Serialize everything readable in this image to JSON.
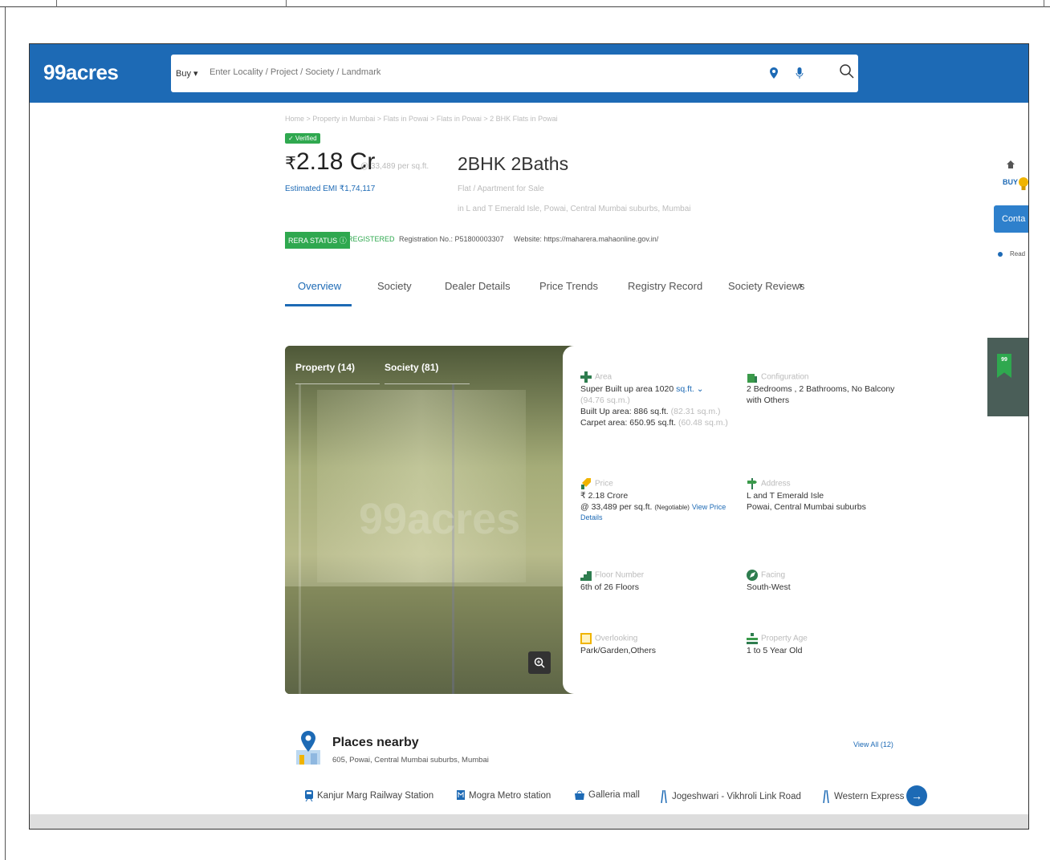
{
  "header": {
    "logo": "99acres",
    "search_type": "Buy",
    "search_placeholder": "Enter Locality / Project / Society / Landmark"
  },
  "breadcrumb": "Home > Property in Mumbai > Flats in Powai > Flats in Powai > 2 BHK Flats in Powai",
  "listing": {
    "verified_badge": "✓ Verified",
    "price": "2.18 Cr",
    "currency": "₹",
    "price_per_sqft": "@ 33,489 per sq.ft.",
    "emi": "Estimated EMI ₹1,74,117",
    "configuration": "2BHK 2Baths",
    "subtype": "Flat / Apartment for Sale",
    "sub_location": "in L and T Emerald Isle, Powai, Central Mumbai suburbs, Mumbai"
  },
  "rera": {
    "status_label": "RERA STATUS",
    "status_value": "REGISTERED",
    "registration": "Registration No.: P51800003307",
    "website": "Website: https://maharera.mahaonline.gov.in/"
  },
  "tabs": [
    "Overview",
    "Society",
    "Dealer Details",
    "Price Trends",
    "Registry Record",
    "Society Reviews"
  ],
  "gallery": {
    "tab_property": "Property (14)",
    "tab_society": "Society (81)",
    "watermark": "99acres"
  },
  "attributes": {
    "area": {
      "label": "Area",
      "super_built_up": "Super Built up area 1020",
      "unit": "sq.ft.",
      "super_built_up_sqm": "(94.76 sq.m.)",
      "built_up": "Built Up area: 886 sq.ft.",
      "built_up_sqm": "(82.31 sq.m.)",
      "carpet": "Carpet area: 650.95 sq.ft.",
      "carpet_sqm": "(60.48 sq.m.)"
    },
    "configuration": {
      "label": "Configuration",
      "line1": "2 Bedrooms , 2 Bathrooms, No Balcony",
      "line2": "with Others"
    },
    "price": {
      "label": "Price",
      "line1": "₹ 2.18 Crore",
      "line2": "@ 33,489 per sq.ft.",
      "negotiable": "(Negotiable)",
      "link1": "View Price",
      "link2": "Details"
    },
    "address": {
      "label": "Address",
      "line1": "L and T Emerald Isle",
      "line2": "Powai, Central Mumbai suburbs"
    },
    "floor": {
      "label": "Floor Number",
      "line1": "6th of 26 Floors"
    },
    "facing": {
      "label": "Facing",
      "line1": "South-West"
    },
    "overlooking": {
      "label": "Overlooking",
      "line1": "Park/Garden,Others"
    },
    "property_age": {
      "label": "Property Age",
      "line1": "1 to 5 Year Old"
    }
  },
  "nearby": {
    "title": "Places nearby",
    "address": "605, Powai, Central Mumbai suburbs, Mumbai",
    "view_all": "View All (12)",
    "places": [
      "Kanjur Marg Railway Station",
      "Mogra Metro station",
      "Galleria mall",
      "Jogeshwari - Vikhroli Link Road",
      "Western Express"
    ]
  },
  "right_panel": {
    "label": "BUY",
    "contact": "Conta",
    "read": "Read"
  },
  "side_card_badge": "99",
  "colors": {
    "brand_blue": "#1d6ab5",
    "green": "#2fa84f"
  }
}
